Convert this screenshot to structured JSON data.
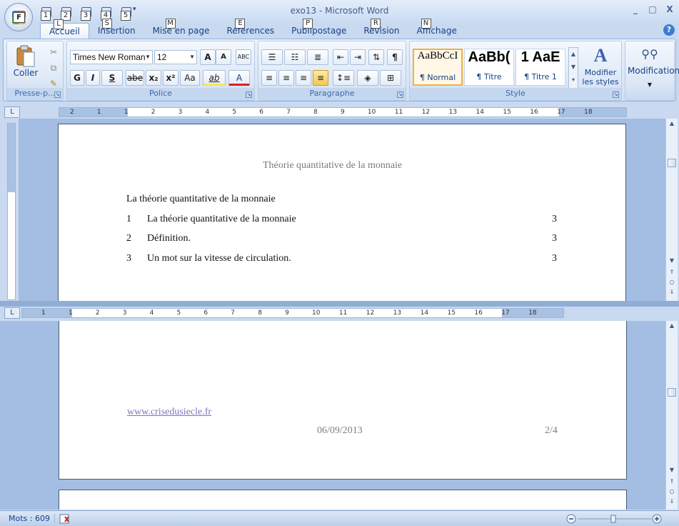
{
  "window": {
    "title": "exo13 - Microsoft Word",
    "controls": [
      "_",
      "□",
      "X"
    ]
  },
  "office_button": {
    "key": "F"
  },
  "qat": {
    "items": [
      {
        "icon": "save-icon",
        "key": "1"
      },
      {
        "icon": "undo-icon",
        "key": "2"
      },
      {
        "icon": "redo-icon",
        "key": "3"
      },
      {
        "icon": "print-preview-icon",
        "key": "4"
      },
      {
        "icon": "open-icon",
        "key": "5"
      }
    ],
    "more": "▾"
  },
  "tabs": [
    {
      "label": "Accueil",
      "key": "L",
      "active": true
    },
    {
      "label": "Insertion",
      "key": "S"
    },
    {
      "label": "Mise en page",
      "key": "M"
    },
    {
      "label": "Références",
      "key": "E"
    },
    {
      "label": "Publipostage",
      "key": "P"
    },
    {
      "label": "Révision",
      "key": "R"
    },
    {
      "label": "Affichage",
      "key": "N"
    }
  ],
  "help": "?",
  "ribbon": {
    "clipboard": {
      "label": "Presse-p...",
      "paste": "Coller"
    },
    "font": {
      "label": "Police",
      "name": "Times New Roman",
      "size": "12",
      "grow": "A",
      "shrink": "A",
      "clear": "ABC",
      "bold": "G",
      "italic": "I",
      "underline": "S",
      "strike": "abe",
      "subscript": "x₂",
      "superscript": "x²",
      "case": "Aa",
      "highlight": "ab",
      "color": "A"
    },
    "paragraph": {
      "label": "Paragraphe",
      "pilcrow": "¶"
    },
    "styles": {
      "label": "Style",
      "tiles": [
        {
          "sample": "AaBbCcI",
          "name": "¶ Normal",
          "selected": true
        },
        {
          "sample": "AaBb(",
          "name": "¶ Titre"
        },
        {
          "sample": "1  AaE",
          "name": "¶ Titre 1"
        }
      ],
      "change_line1": "Modifier",
      "change_line2": "les styles"
    },
    "editing": {
      "label": "Modification"
    }
  },
  "ruler": {
    "top_numbers": [
      "2",
      "1",
      "1",
      "2",
      "3",
      "4",
      "5",
      "6",
      "7",
      "8",
      "9",
      "10",
      "11",
      "12",
      "13",
      "14",
      "15",
      "16",
      "17",
      "18"
    ],
    "bottom_numbers": [
      "1",
      "1",
      "2",
      "3",
      "4",
      "5",
      "6",
      "7",
      "8",
      "9",
      "10",
      "11",
      "12",
      "13",
      "14",
      "15",
      "16",
      "17",
      "18"
    ]
  },
  "document": {
    "header": "Théorie quantitative de la monnaie",
    "toc_title": "La théorie quantitative de la monnaie",
    "toc": [
      {
        "num": "1",
        "text": "La théorie quantitative de la monnaie",
        "page": "3"
      },
      {
        "num": "2",
        "text": "Définition.",
        "page": "3"
      },
      {
        "num": "3",
        "text": "Un mot sur la vitesse de circulation.",
        "page": "3"
      }
    ],
    "footer": {
      "link": "www.crisedusiecle.fr",
      "date": "06/09/2013",
      "page": "2/4"
    }
  },
  "statusbar": {
    "words": "Mots : 609"
  },
  "colors": {
    "accent": "#15428b",
    "ribbon": "#dce7f6",
    "doc_bg": "#a3bde3"
  }
}
